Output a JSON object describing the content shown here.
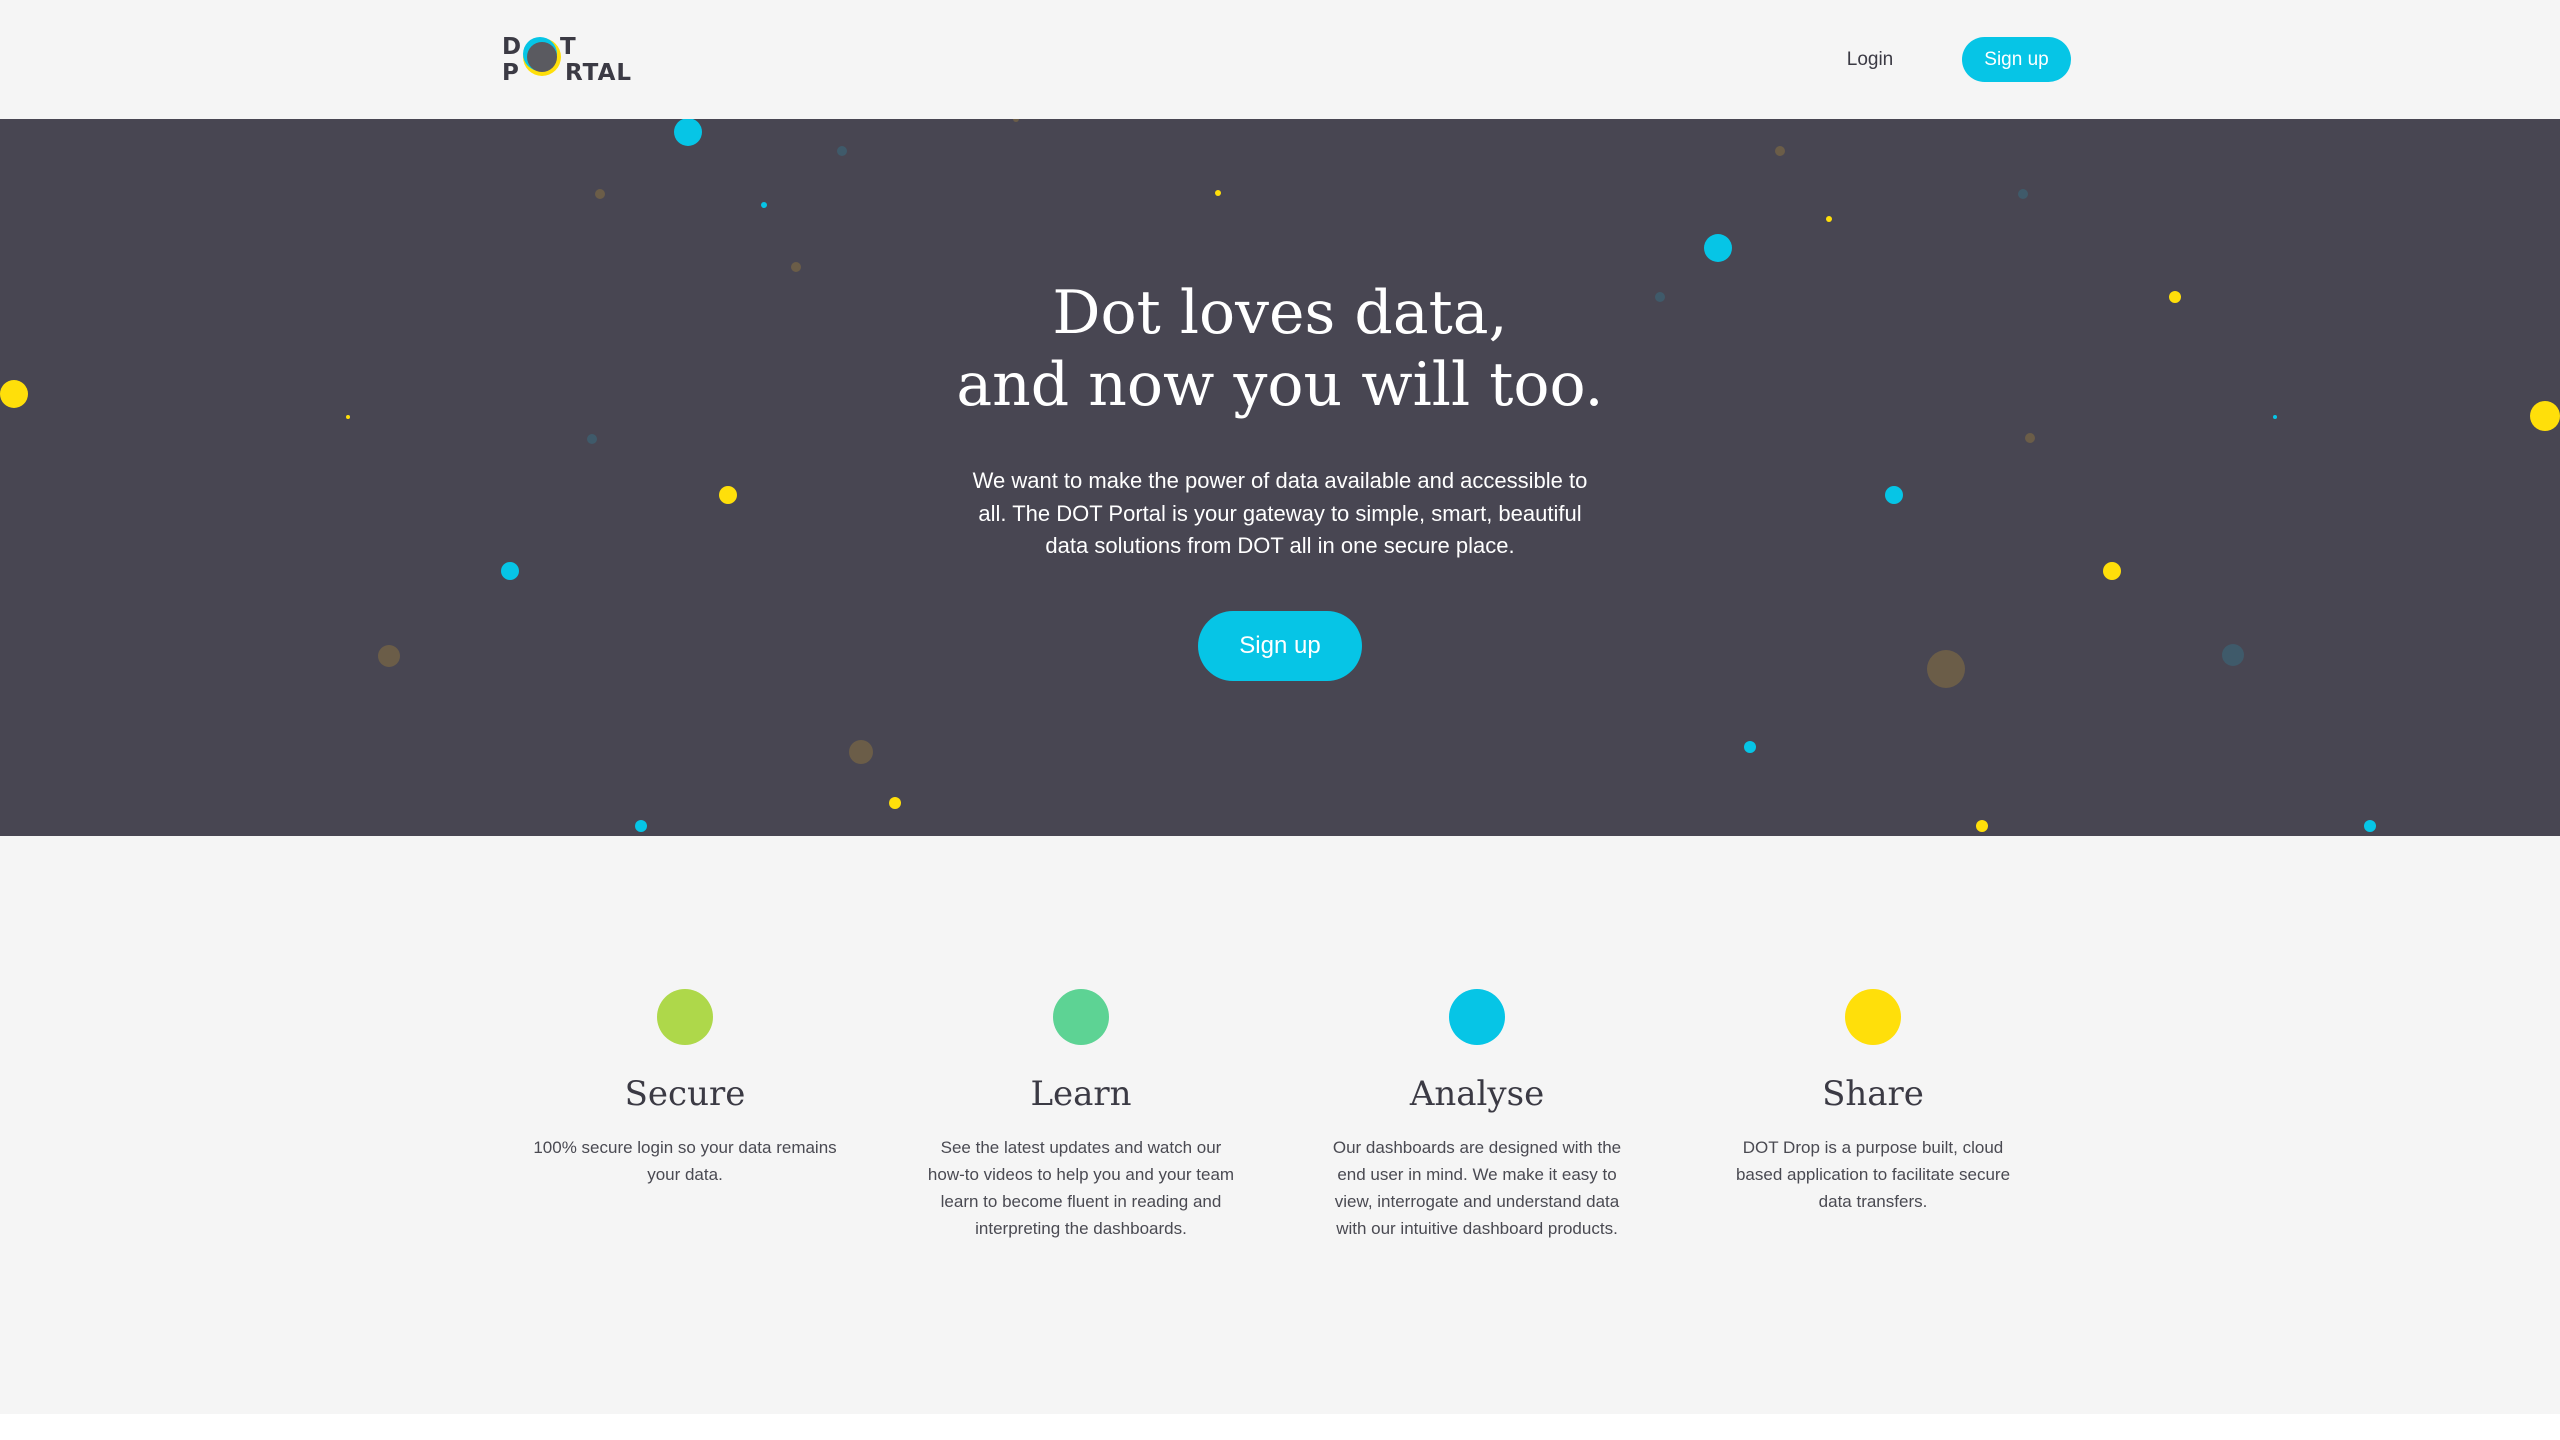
{
  "header": {
    "logo": {
      "line1": [
        "D",
        "T"
      ],
      "line2": [
        "P",
        "RTAL"
      ],
      "alt": "DOT PORTAL"
    },
    "login_label": "Login",
    "signup_label": "Sign up"
  },
  "hero": {
    "title_line1": "Dot loves data,",
    "title_line2": "and now you will too.",
    "body": "We want to make the power of data available and accessible to all. The DOT Portal is your gateway to simple, smart, beautiful data solutions from DOT all in one secure place.",
    "signup_label": "Sign up"
  },
  "features": [
    {
      "title": "Secure",
      "color": "#aed84a",
      "description": "100% secure login so your data remains your data."
    },
    {
      "title": "Learn",
      "color": "#5dd394",
      "description": "See the latest updates and watch our how-to videos to help you and your team learn to become fluent in reading and interpreting the dashboards."
    },
    {
      "title": "Analyse",
      "color": "#06c5e6",
      "description": "Our dashboards are designed with the end user in mind. We make it easy to view, interrogate and understand data with our intuitive dashboard products."
    },
    {
      "title": "Share",
      "color": "#ffdf0a",
      "description": "DOT Drop is a purpose built, cloud based application to facilitate secure data transfers."
    }
  ],
  "colors": {
    "accent": "#06c5e6",
    "hero_background": "#484652",
    "page_background": "#f5f5f5",
    "text_dark": "#3b3a44",
    "yellow": "#ffdf0a"
  }
}
